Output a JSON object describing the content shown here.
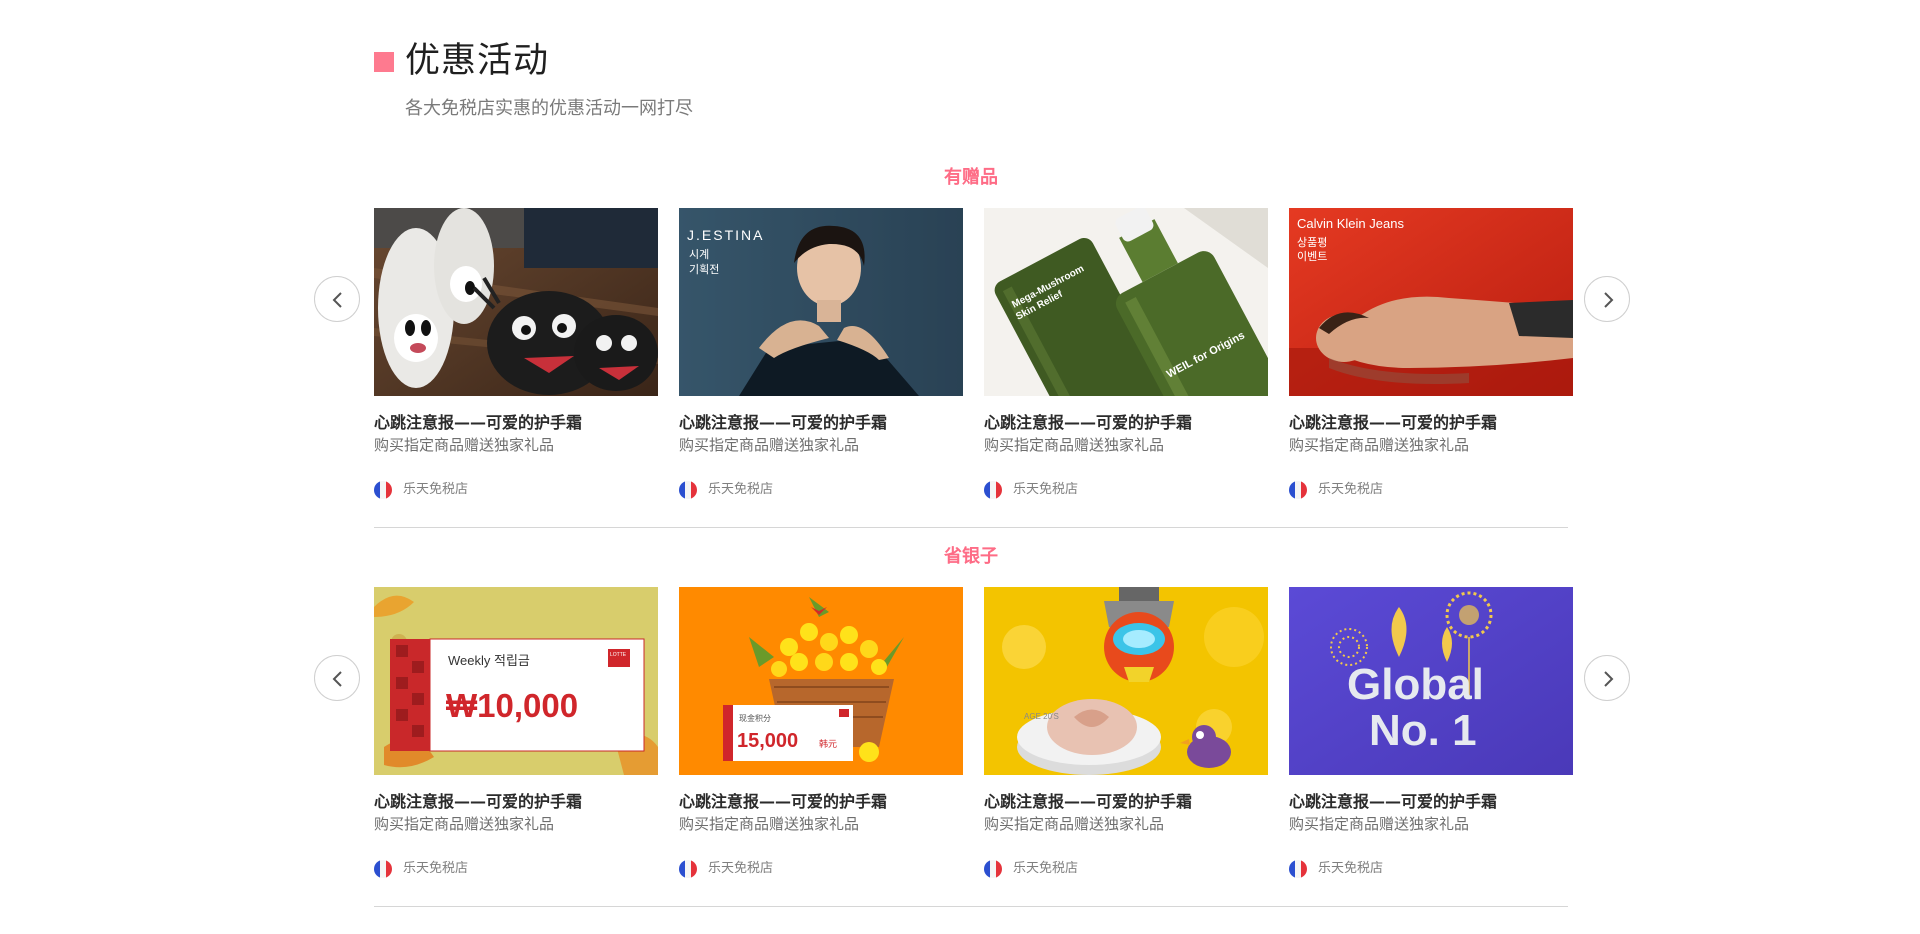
{
  "header": {
    "title": "优惠活动",
    "subtitle": "各大免税店实惠的优惠活动一网打尽",
    "accent_color": "#fe7a8f"
  },
  "sections": [
    {
      "title": "有赠品",
      "prev_icon": "chevron-left-icon",
      "next_icon": "chevron-right-icon",
      "cards": [
        {
          "image_subject": "slippers-photo",
          "title": "心跳注意报——可爱的护手霜",
          "desc": "购买指定商品赠送独家礼品",
          "store": "乐天免税店",
          "flag_icon": "france-flag-icon"
        },
        {
          "image_subject": "jestina-model-photo",
          "image_text": {
            "brand": "J.ESTINA",
            "line1": "시계",
            "line2": "기획전"
          },
          "title": "心跳注意报——可爱的护手霜",
          "desc": "购买指定商品赠送独家礼品",
          "store": "乐天免税店",
          "flag_icon": "france-flag-icon"
        },
        {
          "image_subject": "origins-bottle-photo",
          "image_text": {
            "label1": "Mega-Mushroom",
            "label2": "Skin Relief",
            "label3": "WEIL for Origins"
          },
          "title": "心跳注意报——可爱的护手霜",
          "desc": "购买指定商品赠送独家礼品",
          "store": "乐天免税店",
          "flag_icon": "france-flag-icon"
        },
        {
          "image_subject": "calvin-klein-model-photo",
          "image_text": {
            "brand": "Calvin Klein Jeans",
            "line1": "상품평",
            "line2": "이벤트"
          },
          "title": "心跳注意报——可爱的护手霜",
          "desc": "购买指定商品赠送独家礼品",
          "store": "乐天免税店",
          "flag_icon": "france-flag-icon"
        }
      ]
    },
    {
      "title": "省银子",
      "prev_icon": "chevron-left-icon",
      "next_icon": "chevron-right-icon",
      "cards": [
        {
          "image_subject": "weekly-points-banner",
          "image_text": {
            "heading": "Weekly 적립금",
            "amount": "₩10,000",
            "logo": "LOTTE"
          },
          "title": "心跳注意报——可爱的护手霜",
          "desc": "购买指定商品赠送独家礼品",
          "store": "乐天免税店",
          "flag_icon": "france-flag-icon"
        },
        {
          "image_subject": "flower-basket-banner",
          "image_text": {
            "label": "现金积分",
            "amount": "15,000",
            "unit": "韩元"
          },
          "title": "心跳注意报——可爱的护手霜",
          "desc": "购买指定商品赠送独家礼品",
          "store": "乐天免税店",
          "flag_icon": "france-flag-icon"
        },
        {
          "image_subject": "cushion-compact-cartoon-banner",
          "image_text": {
            "label": "AGE 20'S"
          },
          "title": "心跳注意报——可爱的护手霜",
          "desc": "购买指定商品赠送独家礼品",
          "store": "乐天免税店",
          "flag_icon": "france-flag-icon"
        },
        {
          "image_subject": "global-no1-banner",
          "image_text": {
            "line1": "Global",
            "line2": "No. 1"
          },
          "title": "心跳注意报——可爱的护手霜",
          "desc": "购买指定商品赠送独家礼品",
          "store": "乐天免税店",
          "flag_icon": "france-flag-icon"
        }
      ]
    }
  ]
}
